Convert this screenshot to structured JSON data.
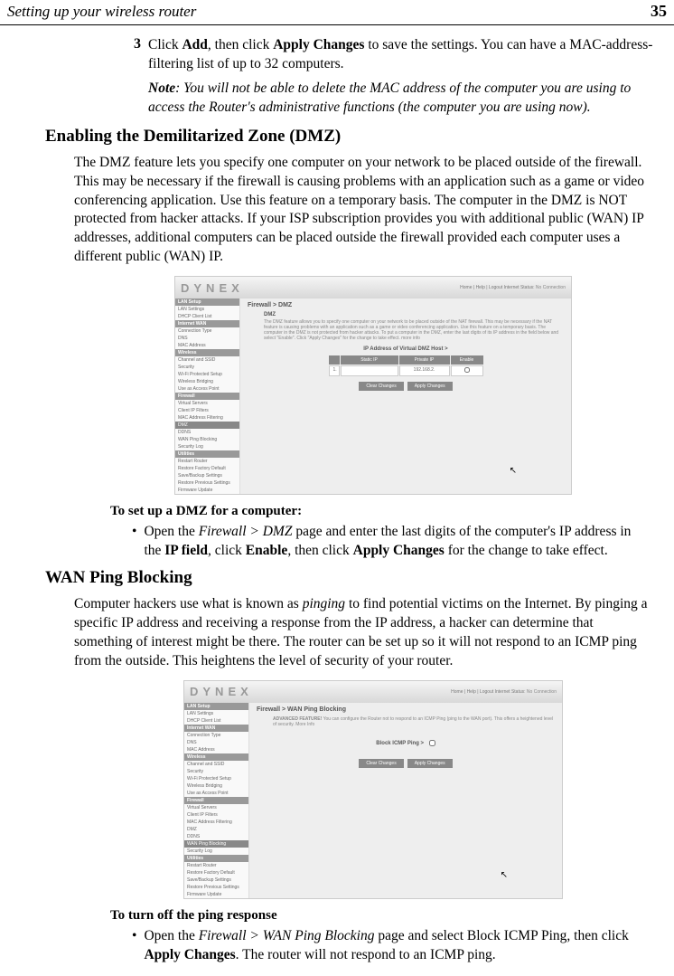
{
  "header": {
    "title": "Setting up your wireless router",
    "page_number": "35"
  },
  "step3": {
    "number": "3",
    "text_pre": "Click ",
    "bold1": "Add",
    "text_mid1": ", then click ",
    "bold2": "Apply Changes",
    "text_post": " to save the settings. You can have a MAC-address-filtering list of up to 32 computers."
  },
  "note": {
    "label": "Note",
    "text": ": You will not be able to delete the MAC address of the computer you are using to access the Router's administrative functions (the computer you are using now)."
  },
  "dmz": {
    "heading": "Enabling the Demilitarized Zone (DMZ)",
    "para": "The DMZ feature lets you specify one computer on your network to be placed outside of the firewall. This may be necessary if the firewall is causing problems with an application such as a game or video conferencing application. Use this feature on a temporary basis. The computer in the DMZ is NOT protected from hacker attacks. If your ISP subscription provides you with additional public (WAN) IP addresses, additional computers can be placed outside the firewall provided each computer uses a different public (WAN) IP.",
    "sub_heading": "To set up a DMZ for a computer:",
    "bullet_pre": "Open the ",
    "bullet_italic": "Firewall > DMZ",
    "bullet_mid1": " page and enter the last digits of the computer's IP address in the ",
    "bullet_bold1": "IP field",
    "bullet_mid2": ", click ",
    "bullet_bold2": "Enable",
    "bullet_mid3": ", then click ",
    "bullet_bold3": "Apply Changes",
    "bullet_post": " for the change to take effect."
  },
  "wanping": {
    "heading": "WAN Ping Blocking",
    "para_pre": "Computer hackers use what is known as ",
    "para_italic": "pinging",
    "para_post": " to find potential victims on the Internet. By pinging a specific IP address and receiving a response from the IP address, a hacker can determine that something of interest might be there. The router can be set up so it will not respond to an ICMP ping from the outside. This heightens the level of security of your router.",
    "sub_heading": "To turn off the ping response",
    "bullet_pre": "Open the ",
    "bullet_italic": "Firewall > WAN Ping Blocking",
    "bullet_mid": " page and select Block ICMP Ping, then click ",
    "bullet_bold": "Apply Changes",
    "bullet_post": ". The router will not respond to an ICMP ping."
  },
  "router_ui_dmz": {
    "logo": "DYNEX",
    "top_links": "Home | Help | Logout  Internet Status:",
    "status": "No Connection",
    "sidebar": {
      "sections": [
        {
          "header": "LAN Setup",
          "items": [
            "LAN Settings",
            "DHCP Client List"
          ]
        },
        {
          "header": "Internet WAN",
          "items": [
            "Connection Type",
            "DNS",
            "MAC Address"
          ]
        },
        {
          "header": "Wireless",
          "items": [
            "Channel and SSID",
            "Security",
            "Wi-Fi Protected Setup",
            "Wireless Bridging",
            "Use as Access Point"
          ]
        },
        {
          "header": "Firewall",
          "items": [
            "Virtual Servers",
            "Client IP Filters",
            "MAC Address Filtering",
            "DMZ",
            "DDNS",
            "WAN Ping Blocking",
            "Security Log"
          ],
          "active": "DMZ"
        },
        {
          "header": "Utilities",
          "items": [
            "Restart Router",
            "Restore Factory Default",
            "Save/Backup Settings",
            "Restore Previous Settings",
            "Firmware Update"
          ]
        }
      ]
    },
    "main_title": "Firewall > DMZ",
    "main_subtitle": "DMZ",
    "main_desc": "The DMZ feature allows you to specify one computer on your network to be placed outside of the NAT firewall. This may be necessary if the NAT feature is causing problems with an application such as a game or video conferencing application. Use this feature on a temporary basis. The computer in the DMZ is not protected from hacker attacks. To put a computer in the DMZ, enter the last digits of its IP address in the field below and select \"Enable\". Click \"Apply Changes\" for the change to take effect. more info",
    "field_label": "IP Address of Virtual DMZ Host >",
    "table": {
      "headers": [
        "",
        "Static IP",
        "Private IP",
        "Enable"
      ],
      "row": [
        "1.",
        "",
        "192.168.2.",
        ""
      ]
    },
    "buttons": {
      "clear": "Clear Changes",
      "apply": "Apply Changes"
    }
  },
  "router_ui_ping": {
    "logo": "DYNEX",
    "top_links": "Home | Help | Logout  Internet Status:",
    "status": "No Connection",
    "sidebar": {
      "sections": [
        {
          "header": "LAN Setup",
          "items": [
            "LAN Settings",
            "DHCP Client List"
          ]
        },
        {
          "header": "Internet WAN",
          "items": [
            "Connection Type",
            "DNS",
            "MAC Address"
          ]
        },
        {
          "header": "Wireless",
          "items": [
            "Channel and SSID",
            "Security",
            "Wi-Fi Protected Setup",
            "Wireless Bridging",
            "Use as Access Point"
          ]
        },
        {
          "header": "Firewall",
          "items": [
            "Virtual Servers",
            "Client IP Filters",
            "MAC Address Filtering",
            "DMZ",
            "DDNS",
            "WAN Ping Blocking",
            "Security Log"
          ],
          "active": "WAN Ping Blocking"
        },
        {
          "header": "Utilities",
          "items": [
            "Restart Router",
            "Restore Factory Default",
            "Save/Backup Settings",
            "Restore Previous Settings",
            "Firmware Update"
          ]
        }
      ]
    },
    "main_title": "Firewall > WAN Ping Blocking",
    "main_desc_bold": "ADVANCED FEATURE!",
    "main_desc": " You can configure the Router not to respond to an ICMP Ping (ping to the WAN port). This offers a heightened level of security. More Info",
    "field_label": "Block ICMP Ping >",
    "buttons": {
      "clear": "Clear Changes",
      "apply": "Apply Changes"
    }
  }
}
